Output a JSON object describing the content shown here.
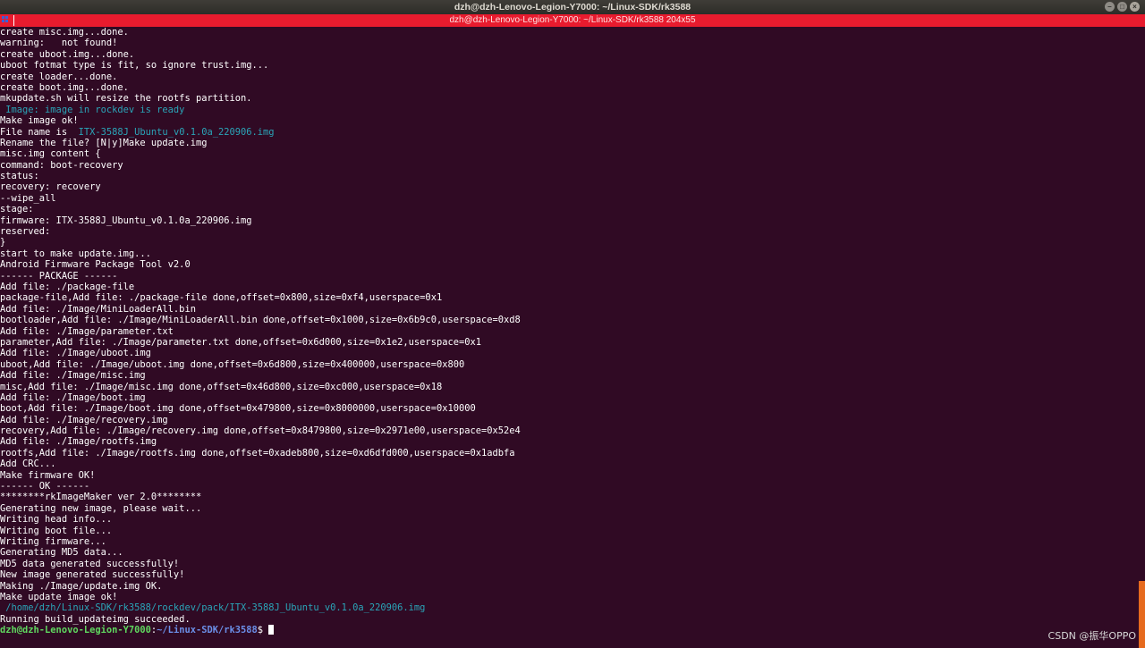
{
  "window": {
    "title": "dzh@dzh-Lenovo-Legion-Y7000: ~/Linux-SDK/rk3588",
    "tab_title": "dzh@dzh-Lenovo-Legion-Y7000: ~/Linux-SDK/rk3588 204x55"
  },
  "terminal": {
    "lines": [
      {
        "text": "create misc.img...done.",
        "style": "normal"
      },
      {
        "text": "warning:   not found!",
        "style": "normal"
      },
      {
        "text": "create uboot.img...done.",
        "style": "normal"
      },
      {
        "text": "uboot fotmat type is fit, so ignore trust.img...",
        "style": "normal"
      },
      {
        "text": "create loader...done.",
        "style": "normal"
      },
      {
        "text": "create boot.img...done.",
        "style": "normal"
      },
      {
        "text": "mkupdate.sh will resize the rootfs partition.",
        "style": "normal"
      },
      {
        "text": " Image: image in rockdev is ready",
        "style": "cyan"
      },
      {
        "text": "Make image ok!",
        "style": "normal"
      },
      {
        "text": "File name is  ",
        "style": "normal",
        "highlight": "ITX-3588J_Ubuntu_v0.1.0a_220906.img"
      },
      {
        "text": "Rename the file? [N|y]Make update.img",
        "style": "normal"
      },
      {
        "text": "misc.img content {",
        "style": "normal"
      },
      {
        "text": "command: boot-recovery",
        "style": "normal"
      },
      {
        "text": "status:",
        "style": "normal"
      },
      {
        "text": "recovery: recovery",
        "style": "normal"
      },
      {
        "text": "--wipe_all",
        "style": "normal"
      },
      {
        "text": "stage:",
        "style": "normal"
      },
      {
        "text": "firmware: ITX-3588J_Ubuntu_v0.1.0a_220906.img",
        "style": "normal"
      },
      {
        "text": "reserved:",
        "style": "normal"
      },
      {
        "text": "}",
        "style": "normal"
      },
      {
        "text": "start to make update.img...",
        "style": "normal"
      },
      {
        "text": "Android Firmware Package Tool v2.0",
        "style": "normal"
      },
      {
        "text": "------ PACKAGE ------",
        "style": "normal"
      },
      {
        "text": "Add file: ./package-file",
        "style": "normal"
      },
      {
        "text": "package-file,Add file: ./package-file done,offset=0x800,size=0xf4,userspace=0x1",
        "style": "normal"
      },
      {
        "text": "Add file: ./Image/MiniLoaderAll.bin",
        "style": "normal"
      },
      {
        "text": "bootloader,Add file: ./Image/MiniLoaderAll.bin done,offset=0x1000,size=0x6b9c0,userspace=0xd8",
        "style": "normal"
      },
      {
        "text": "Add file: ./Image/parameter.txt",
        "style": "normal"
      },
      {
        "text": "parameter,Add file: ./Image/parameter.txt done,offset=0x6d000,size=0x1e2,userspace=0x1",
        "style": "normal"
      },
      {
        "text": "Add file: ./Image/uboot.img",
        "style": "normal"
      },
      {
        "text": "uboot,Add file: ./Image/uboot.img done,offset=0x6d800,size=0x400000,userspace=0x800",
        "style": "normal"
      },
      {
        "text": "Add file: ./Image/misc.img",
        "style": "normal"
      },
      {
        "text": "misc,Add file: ./Image/misc.img done,offset=0x46d800,size=0xc000,userspace=0x18",
        "style": "normal"
      },
      {
        "text": "Add file: ./Image/boot.img",
        "style": "normal"
      },
      {
        "text": "boot,Add file: ./Image/boot.img done,offset=0x479800,size=0x8000000,userspace=0x10000",
        "style": "normal"
      },
      {
        "text": "Add file: ./Image/recovery.img",
        "style": "normal"
      },
      {
        "text": "recovery,Add file: ./Image/recovery.img done,offset=0x8479800,size=0x2971e00,userspace=0x52e4",
        "style": "normal"
      },
      {
        "text": "Add file: ./Image/rootfs.img",
        "style": "normal"
      },
      {
        "text": "rootfs,Add file: ./Image/rootfs.img done,offset=0xadeb800,size=0xd6dfd000,userspace=0x1adbfa",
        "style": "normal"
      },
      {
        "text": "Add CRC...",
        "style": "normal"
      },
      {
        "text": "Make firmware OK!",
        "style": "normal"
      },
      {
        "text": "------ OK ------",
        "style": "normal"
      },
      {
        "text": "********rkImageMaker ver 2.0********",
        "style": "normal"
      },
      {
        "text": "Generating new image, please wait...",
        "style": "normal"
      },
      {
        "text": "Writing head info...",
        "style": "normal"
      },
      {
        "text": "Writing boot file...",
        "style": "normal"
      },
      {
        "text": "Writing firmware...",
        "style": "normal"
      },
      {
        "text": "Generating MD5 data...",
        "style": "normal"
      },
      {
        "text": "MD5 data generated successfully!",
        "style": "normal"
      },
      {
        "text": "New image generated successfully!",
        "style": "normal"
      },
      {
        "text": "Making ./Image/update.img OK.",
        "style": "normal"
      },
      {
        "text": "Make update image ok!",
        "style": "normal"
      },
      {
        "text": " /home/dzh/Linux-SDK/rk3588/rockdev/pack/ITX-3588J_Ubuntu_v0.1.0a_220906.img",
        "style": "cyan"
      },
      {
        "text": "Running build_updateimg succeeded.",
        "style": "normal"
      }
    ],
    "prompt": {
      "user_host": "dzh@dzh-Lenovo-Legion-Y7000",
      "separator": ":",
      "path": "~/Linux-SDK/rk3588",
      "symbol": "$ "
    }
  },
  "watermark": "CSDN @振华OPPO",
  "colors": {
    "background": "#300a24",
    "tab_bar": "#e81b2e",
    "cyan_text": "#2aa5b8",
    "prompt_user": "#5fd75f",
    "prompt_path": "#6b8fe8",
    "scroll_thumb": "#e66a1e"
  },
  "icons": {
    "tab_menu": "tab-menu-icon",
    "window_controls": [
      "minimize-icon",
      "maximize-icon",
      "close-icon"
    ]
  }
}
